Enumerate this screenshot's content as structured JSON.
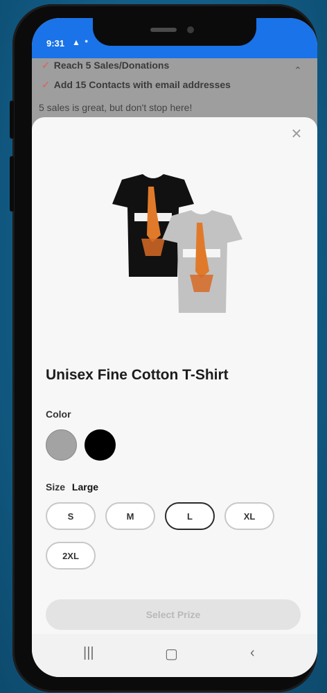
{
  "status_bar": {
    "time": "9:31",
    "icon": "alert-triangle-icon"
  },
  "background": {
    "goals": [
      {
        "text": "Reach 5 Sales/Donations"
      },
      {
        "text": "Add 15 Contacts with email addresses"
      }
    ],
    "note": "5 sales is great, but don't stop here!"
  },
  "product": {
    "title": "Unisex Fine Cotton T-Shirt",
    "color_label": "Color",
    "colors": [
      {
        "name": "gray",
        "hex": "#a3a3a3"
      },
      {
        "name": "black",
        "hex": "#000000"
      }
    ],
    "size_label": "Size",
    "selected_size": "Large",
    "sizes": [
      "S",
      "M",
      "L",
      "XL",
      "2XL"
    ],
    "selected_size_index": 2
  },
  "cta": {
    "label": "Select Prize"
  },
  "colors": {
    "status_bar": "#1a73e8",
    "sheet": "#f7f7f7",
    "accent_orange": "#e07a2a"
  }
}
